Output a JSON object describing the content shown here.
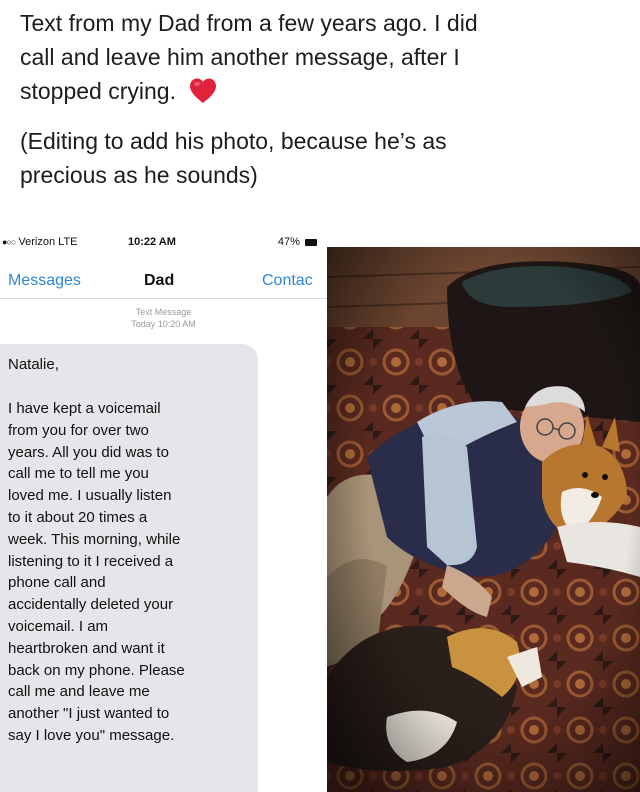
{
  "caption": {
    "lines_p1": [
      "Text from my Dad from a few years ago.  I did",
      "call and leave him another message, after I",
      "stopped crying."
    ],
    "lines_p2": [
      "(Editing to add his photo, because he’s as",
      "precious as he sounds)"
    ],
    "heart_icon": "red-heart-emoji"
  },
  "phone": {
    "status_bar": {
      "carrier": "Verizon",
      "network": "LTE",
      "time": "10:22 AM",
      "battery": "47%"
    },
    "nav": {
      "back_label": "Messages",
      "title": "Dad",
      "contact_label": "Contac"
    },
    "meta": {
      "type": "Text Message",
      "timestamp": "Today 10:20 AM"
    },
    "message": {
      "greeting": "Natalie,",
      "lines": [
        "I have kept a voicemail",
        "from you for over two",
        "years.  All you did was to",
        "call me to tell me you",
        "loved me.  I usually listen",
        "to it about 20 times a",
        "week.  This morning, while",
        "listening to it I received a",
        "phone call and",
        "accidentally deleted your",
        "voicemail.  I am",
        "heartbroken and want it",
        "back on my phone.  Please",
        "call me and leave me",
        "another \"I just wanted to",
        "say I love you\" message."
      ]
    }
  },
  "colors": {
    "ios_blue": "#2f86d8",
    "bubble_gray": "#e6e6ea",
    "heart_red": "#e0233b"
  }
}
